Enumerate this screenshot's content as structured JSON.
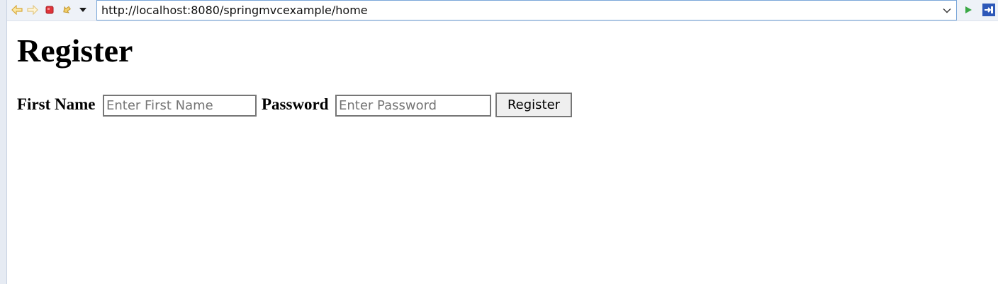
{
  "browser": {
    "toolbar": {
      "icons": [
        "back-icon",
        "forward-icon",
        "stop-icon",
        "refresh-icon",
        "history-menu-icon"
      ],
      "address": "http://localhost:8080/springmvcexample/home",
      "go_icon": "go-icon",
      "bookmark_icon": "bookmark-icon"
    },
    "colors": {
      "toolbar_bg": "#eef2f8",
      "address_border": "#7aa7d9",
      "stop": "#e0343a",
      "arrow": "#f0c040",
      "go": "#3aa845",
      "bookmark": "#2d58b8"
    }
  },
  "page": {
    "title": "Register",
    "form": {
      "first_name_label": "First Name",
      "first_name_placeholder": "Enter First Name",
      "first_name_value": "",
      "password_label": "Password",
      "password_placeholder": "Enter Password",
      "password_value": "",
      "submit_label": "Register"
    }
  }
}
